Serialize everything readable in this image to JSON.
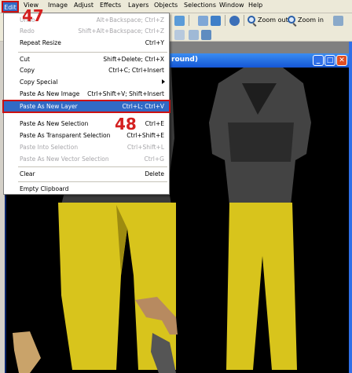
{
  "menubar": {
    "items": [
      {
        "label": "Edit"
      },
      {
        "label": "View"
      },
      {
        "label": "Image"
      },
      {
        "label": "Adjust"
      },
      {
        "label": "Effects"
      },
      {
        "label": "Layers"
      },
      {
        "label": "Objects"
      },
      {
        "label": "Selections"
      },
      {
        "label": "Window"
      },
      {
        "label": "Help"
      }
    ]
  },
  "toolbar": {
    "zoom_out_label": "Zoom out",
    "zoom_in_label": "Zoom in"
  },
  "image_window": {
    "title_fragment": "round)"
  },
  "edit_menu": {
    "items": [
      {
        "label": "Undo",
        "shortcut": "Alt+Backspace; Ctrl+Z",
        "disabled": true
      },
      {
        "label": "Redo",
        "shortcut": "Shift+Alt+Backspace; Ctrl+Z",
        "disabled": true
      },
      {
        "label": "Repeat  Resize",
        "shortcut": "Ctrl+Y",
        "disabled": false
      },
      {
        "label": "Cut",
        "shortcut": "Shift+Delete; Ctrl+X",
        "disabled": false
      },
      {
        "label": "Copy",
        "shortcut": "Ctrl+C; Ctrl+Insert",
        "disabled": false
      },
      {
        "label": "Copy Special",
        "shortcut": "",
        "disabled": false,
        "submenu": true
      },
      {
        "label": "Paste As New Image",
        "shortcut": "Ctrl+Shift+V; Shift+Insert",
        "disabled": false
      },
      {
        "label": "Paste As New Layer",
        "shortcut": "Ctrl+L; Ctrl+V",
        "disabled": false,
        "highlighted": true
      },
      {
        "label": "Paste As New Selection",
        "shortcut": "Ctrl+E",
        "disabled": false
      },
      {
        "label": "Paste As Transparent Selection",
        "shortcut": "Ctrl+Shift+E",
        "disabled": false
      },
      {
        "label": "Paste Into Selection",
        "shortcut": "Ctrl+Shift+L",
        "disabled": true
      },
      {
        "label": "Paste As New Vector Selection",
        "shortcut": "Ctrl+G",
        "disabled": true
      },
      {
        "label": "Clear",
        "shortcut": "Delete",
        "disabled": false
      },
      {
        "label": "Empty Clipboard",
        "shortcut": "",
        "disabled": false
      }
    ]
  },
  "annotations": {
    "step_menu": "47",
    "step_item": "48"
  },
  "colors": {
    "menu_highlight": "#316ac5",
    "annotation_red": "#cc1111",
    "titlebar_blue": "#1556d6",
    "pants_yellow": "#d8c41c"
  }
}
